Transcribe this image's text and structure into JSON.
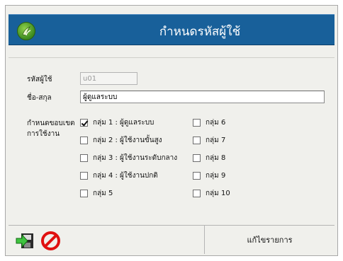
{
  "title": "กำหนดรหัสผู้ใช้",
  "form": {
    "user_id_label": "รหัสผู้ใช้",
    "user_id_value": "u01",
    "fullname_label": "ชื่อ-สกุล",
    "fullname_value": "ผู้ดูแลระบบ",
    "scope_label_line1": "กำหนดขอบเขต",
    "scope_label_line2": "การใช้งาน"
  },
  "groups": [
    {
      "label": "กลุ่ม 1 : ผู้ดูแลระบบ",
      "checked": true
    },
    {
      "label": "กลุ่ม 2 : ผู้ใช้งานขั้นสูง",
      "checked": false
    },
    {
      "label": "กลุ่ม 3 : ผู้ใช้งานระดับกลาง",
      "checked": false
    },
    {
      "label": "กลุ่ม 4 : ผู้ใช้งานปกติ",
      "checked": false
    },
    {
      "label": "กลุ่ม 5",
      "checked": false
    },
    {
      "label": "กลุ่ม 6",
      "checked": false
    },
    {
      "label": "กลุ่ม 7",
      "checked": false
    },
    {
      "label": "กลุ่ม 8",
      "checked": false
    },
    {
      "label": "กลุ่ม 9",
      "checked": false
    },
    {
      "label": "กลุ่ม 10",
      "checked": false
    }
  ],
  "mode_text": "แก้ไขรายการ",
  "icons": {
    "save": "save-exit-icon",
    "cancel": "cancel-icon",
    "logo": "app-logo-icon"
  },
  "colors": {
    "titlebar": "#18609a",
    "panel": "#f0f0ec",
    "cancel_red": "#e01010"
  }
}
